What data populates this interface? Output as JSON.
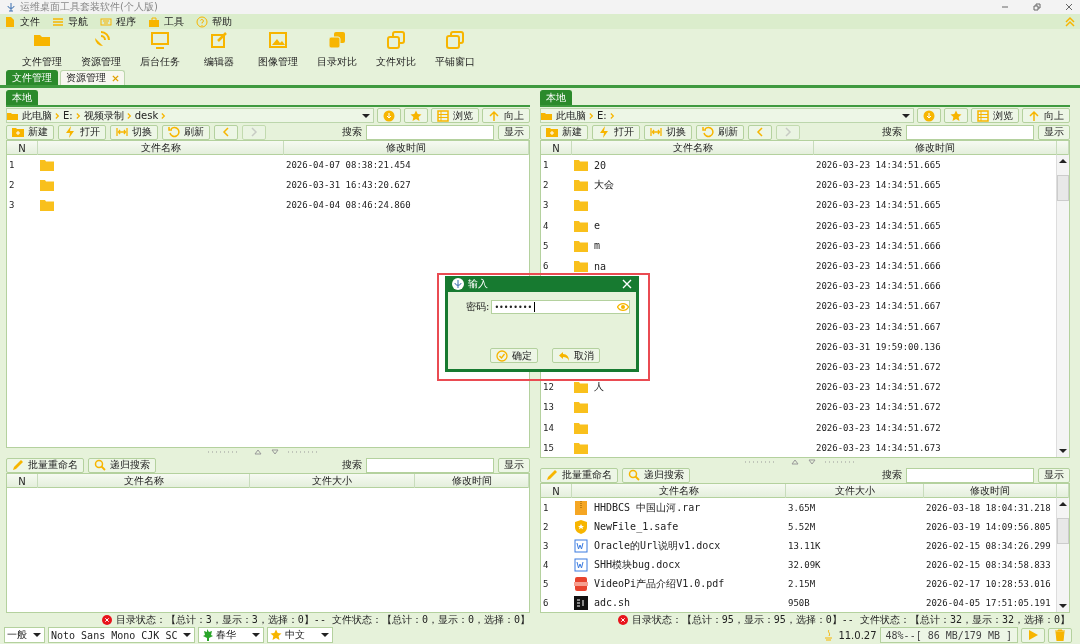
{
  "window": {
    "title": "运维桌面工具套装软件(个人版)"
  },
  "menu": [
    {
      "label": "文件"
    },
    {
      "label": "导航"
    },
    {
      "label": "程序"
    },
    {
      "label": "工具"
    },
    {
      "label": "帮助"
    }
  ],
  "toolbar": [
    {
      "label": "文件管理"
    },
    {
      "label": "资源管理"
    },
    {
      "label": "后台任务"
    },
    {
      "label": "编辑器"
    },
    {
      "label": "图像管理"
    },
    {
      "label": "目录对比"
    },
    {
      "label": "文件对比"
    },
    {
      "label": "平铺窗口"
    }
  ],
  "tabs": [
    {
      "label": "文件管理",
      "selected": true,
      "closable": false
    },
    {
      "label": "资源管理",
      "selected": false,
      "closable": true
    }
  ],
  "panels": [
    {
      "location_tab": "本地",
      "path": [
        "此电脑",
        "E:",
        "视频录制",
        "desk"
      ],
      "browse": "浏览",
      "up": "向上",
      "actions": [
        "新建",
        "打开",
        "切换",
        "刷新"
      ],
      "search_label": "搜索",
      "show_button": "显示",
      "dir_columns": [
        "N",
        "文件名称",
        "修改时间"
      ],
      "dirs": [
        {
          "n": "1",
          "modified": "2026-04-07 08:38:21.454"
        },
        {
          "n": "2",
          "modified": "2026-03-31 16:43:20.627"
        },
        {
          "n": "3",
          "modified": "2026-04-04 08:46:24.860"
        }
      ],
      "file_actions": [
        "批量重命名",
        "递归搜索"
      ],
      "file_search_label": "搜索",
      "file_show_button": "显示",
      "file_columns": [
        "N",
        "文件名称",
        "文件大小",
        "修改时间"
      ],
      "status": "目录状态：【总计：3，显示：3，选择：0】-- 文件状态：【总计：0，显示：0，选择：0】"
    },
    {
      "location_tab": "本地",
      "path": [
        "此电脑",
        "E:"
      ],
      "browse": "浏览",
      "up": "向上",
      "actions": [
        "新建",
        "打开",
        "切换",
        "刷新"
      ],
      "search_label": "搜索",
      "show_button": "显示",
      "dir_columns": [
        "N",
        "文件名称",
        "修改时间"
      ],
      "dirs": [
        {
          "n": "1",
          "name": "20",
          "modified": "2026-03-23 14:34:51.665"
        },
        {
          "n": "2",
          "name": "大会",
          "modified": "2026-03-23 14:34:51.665"
        },
        {
          "n": "3",
          "modified": "2026-03-23 14:34:51.665"
        },
        {
          "n": "4",
          "name": "e",
          "modified": "2026-03-23 14:34:51.665"
        },
        {
          "n": "5",
          "name": "m",
          "modified": "2026-03-23 14:34:51.666"
        },
        {
          "n": "6",
          "name": "na",
          "modified": "2026-03-23 14:34:51.666"
        },
        {
          "modified": "2026-03-23 14:34:51.666"
        },
        {
          "modified": "2026-03-23 14:34:51.667"
        },
        {
          "modified": "2026-03-23 14:34:51.667"
        },
        {
          "modified": "2026-03-31 19:59:00.136"
        },
        {
          "modified": "2026-03-23 14:34:51.672"
        },
        {
          "n": "12",
          "name": "人",
          "modified": "2026-03-23 14:34:51.672"
        },
        {
          "n": "13",
          "modified": "2026-03-23 14:34:51.672"
        },
        {
          "n": "14",
          "modified": "2026-03-23 14:34:51.672"
        },
        {
          "n": "15",
          "modified": "2026-03-23 14:34:51.673"
        }
      ],
      "file_actions": [
        "批量重命名",
        "递归搜索"
      ],
      "file_search_label": "搜索",
      "file_show_button": "显示",
      "file_columns": [
        "N",
        "文件名称",
        "文件大小",
        "修改时间"
      ],
      "files": [
        {
          "n": "1",
          "kind": "rar",
          "name": "HHDBCS 中国山河.rar",
          "size": "3.65M",
          "modified": "2026-03-18 18:04:31.218"
        },
        {
          "n": "2",
          "kind": "safe",
          "name": "NewFile_1.safe",
          "size": "5.52M",
          "modified": "2026-03-19 14:09:56.805"
        },
        {
          "n": "3",
          "kind": "docx",
          "name": "Oracle的Url说明v1.docx",
          "size": "13.11K",
          "modified": "2026-02-15 08:34:26.299"
        },
        {
          "n": "4",
          "kind": "docx",
          "name": "SHH模块bug.docx",
          "size": "32.09K",
          "modified": "2026-02-15 08:34:58.833"
        },
        {
          "n": "5",
          "kind": "pdf",
          "name": "VideoPi产品介绍V1.0.pdf",
          "size": "2.15M",
          "modified": "2026-02-17 10:28:53.016"
        },
        {
          "n": "6",
          "kind": "sh",
          "name": "adc.sh",
          "size": "950B",
          "modified": "2026-04-05 17:51:05.191"
        }
      ],
      "status": "目录状态：【总计：95，显示：95，选择：0】-- 文件状态：【总计：32，显示：32，选择：0】"
    }
  ],
  "dialog": {
    "title": "输入",
    "field_label": "密码:",
    "value": "••••••••",
    "ok": "确定",
    "cancel": "取消"
  },
  "bottom_bar": {
    "dropdowns": [
      {
        "value": "一般",
        "kind": "plain"
      },
      {
        "value": "Noto Sans Mono CJK SC",
        "kind": "plain"
      },
      {
        "value": "春华",
        "kind": "leaf"
      },
      {
        "value": "中文",
        "kind": "star"
      }
    ],
    "version": "11.0.27",
    "memory": "48%--[ 86 MB/179 MB ]"
  }
}
